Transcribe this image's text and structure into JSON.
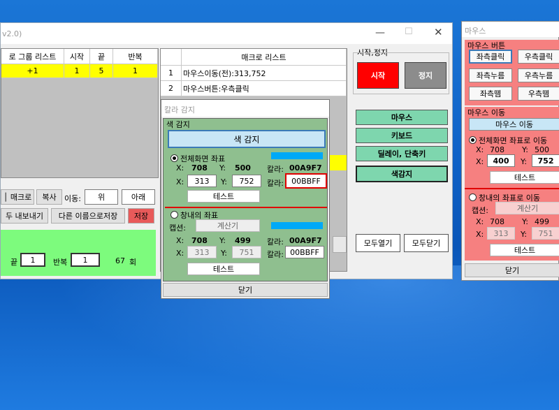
{
  "main_window": {
    "title_fragment": "v2.0)",
    "group_list": {
      "headers": [
        "로 그룹 리스트",
        "시작",
        "끝",
        "반복"
      ],
      "rows": [
        [
          "+1",
          "1",
          "5",
          "1"
        ]
      ]
    },
    "buttons": {
      "macro": "│ 매크로",
      "copy": "복사",
      "move_label": "이동:",
      "up": "위",
      "down": "아래",
      "export_all": "두 내보내기",
      "save_as": "다른 이름으로저장",
      "save": "저장"
    },
    "repeat_row": {
      "end_label": "끝",
      "end_value": "1",
      "repeat_label": "반복",
      "repeat_value": "1",
      "count": "67",
      "count_unit": "회"
    },
    "macro_list": {
      "header": "매크로 리스트",
      "rows": [
        {
          "num": "1",
          "text": "마우스이동(전):313,752"
        },
        {
          "num": "2",
          "text": "마우스버튼:우측클릭"
        }
      ]
    },
    "start_stop": {
      "group_title": "시작,정지",
      "start": "시작",
      "stop": "정지"
    },
    "categories": [
      "마우스",
      "키보드",
      "딜레이, 단축키",
      "색감지"
    ],
    "open_all": "모두열기",
    "close_all": "모두닫기"
  },
  "color_dialog": {
    "title": "칼라 감지",
    "group_title": "색 감지",
    "detect_button": "색 감지",
    "fullscreen": {
      "label": "전체화면 좌표",
      "x_label": "X:",
      "x_value": "708",
      "y_label": "Y:",
      "y_value": "500",
      "color_label": "칼라:",
      "color_value": "00A9F7",
      "x_input": "313",
      "y_input": "752",
      "color_input": "00BBFF",
      "test": "테스트"
    },
    "window_coords": {
      "label": "창내의 좌표",
      "caption_label": "캡션:",
      "caption_value": "계산기",
      "x_label": "X:",
      "x_value": "708",
      "y_label": "Y:",
      "y_value": "499",
      "color_label": "칼라:",
      "color_value": "00A9F7",
      "x_input": "313",
      "y_input": "751",
      "color_input": "00BBFF",
      "test": "테스트"
    },
    "close": "닫기",
    "colors": {
      "swatch": "#00A9F7",
      "green_panel": "#8fbf8f",
      "highlight_border": "#e00000"
    }
  },
  "mouse_window": {
    "title": "마우스",
    "button_group_title": "마우스 버튼",
    "buttons": [
      "좌측클릭",
      "우측클릭",
      "좌측누름",
      "우측누름",
      "좌측뗌",
      "우측뗌"
    ],
    "move_group_title": "마우스 이동",
    "move_button": "마우스 이동",
    "fullscreen": {
      "label": "전체화면 좌표로 이동",
      "x_label": "X:",
      "x_value": "708",
      "y_label": "Y:",
      "y_value": "500",
      "x_input": "400",
      "y_input": "752",
      "test": "테스트"
    },
    "window": {
      "label": "창내의 좌표로 이동",
      "caption_label": "캡션:",
      "caption_value": "계산기",
      "x_label": "X:",
      "x_value": "708",
      "y_label": "Y:",
      "y_value": "499",
      "x_input": "313",
      "y_input": "751",
      "test": "테스트"
    },
    "close": "닫기"
  }
}
